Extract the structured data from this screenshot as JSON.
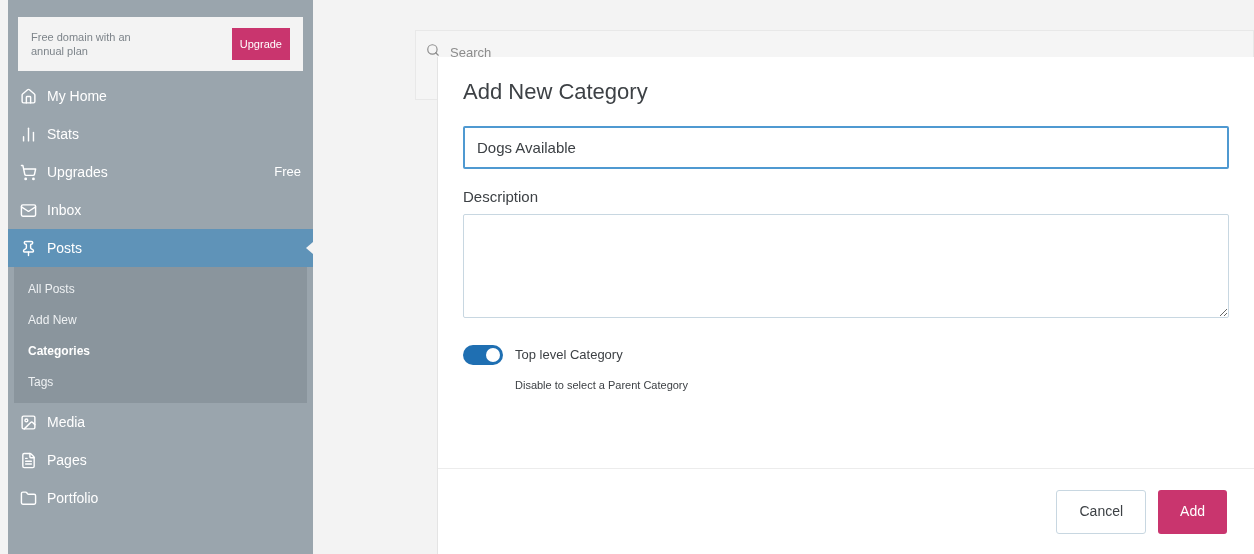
{
  "sidebar": {
    "promo": {
      "text": "Free domain with an annual plan",
      "button": "Upgrade"
    },
    "items": [
      {
        "label": "My Home",
        "selected": false
      },
      {
        "label": "Stats",
        "selected": false
      },
      {
        "label": "Upgrades",
        "badge": "Free",
        "selected": false
      },
      {
        "label": "Inbox",
        "selected": false
      },
      {
        "label": "Posts",
        "selected": true,
        "children": [
          {
            "label": "All Posts",
            "selected": false
          },
          {
            "label": "Add New",
            "selected": false
          },
          {
            "label": "Categories",
            "selected": true
          },
          {
            "label": "Tags",
            "selected": false
          }
        ]
      },
      {
        "label": "Media",
        "selected": false
      },
      {
        "label": "Pages",
        "selected": false
      },
      {
        "label": "Portfolio",
        "selected": false
      }
    ]
  },
  "search": {
    "placeholder": "Search"
  },
  "dialog": {
    "title": "Add New Category",
    "name_value": "Dogs Available",
    "description_label": "Description",
    "toggle": {
      "label": "Top level Category",
      "on": true,
      "hint": "Disable to select a Parent Category"
    },
    "buttons": [
      {
        "label": "Cancel",
        "kind": "secondary"
      },
      {
        "label": "Add",
        "kind": "primary"
      }
    ]
  }
}
